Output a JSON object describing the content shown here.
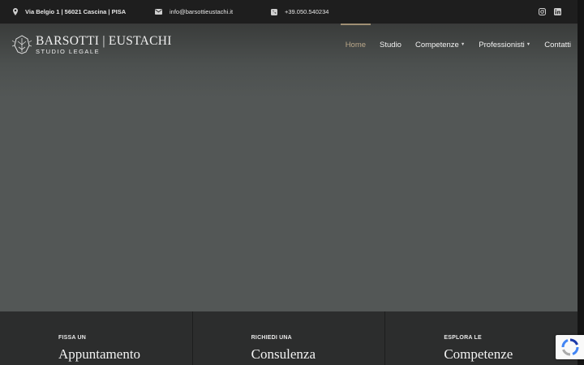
{
  "topbar": {
    "address": "Via Belgio 1 | 56021 Cascina | PISA",
    "email": "info@barsottieustachi.it",
    "phone": "+39.050.540234",
    "icons": {
      "address": "map-marker-icon",
      "email": "envelope-icon",
      "phone": "phone-icon",
      "instagram": "instagram-icon",
      "linkedin": "linkedin-icon"
    }
  },
  "logo": {
    "name": "BARSOTTI | EUSTACHI",
    "subtitle": "STUDIO LEGALE"
  },
  "nav": {
    "items": [
      {
        "label": "Home"
      },
      {
        "label": "Studio"
      },
      {
        "label": "Competenze",
        "caret": "▼"
      },
      {
        "label": "Professionisti",
        "caret": "▼"
      },
      {
        "label": "Contatti"
      }
    ]
  },
  "cards": [
    {
      "kicker": "FISSA UN",
      "title": "Appuntamento"
    },
    {
      "kicker": "RICHIEDI UNA",
      "title": "Consulenza"
    },
    {
      "kicker": "ESPLORA LE",
      "title": "Competenze"
    }
  ],
  "colors": {
    "accent": "#bba88a",
    "topbar": "#1e1e1e",
    "hero": "#535756",
    "card": "#2c2d2d"
  }
}
